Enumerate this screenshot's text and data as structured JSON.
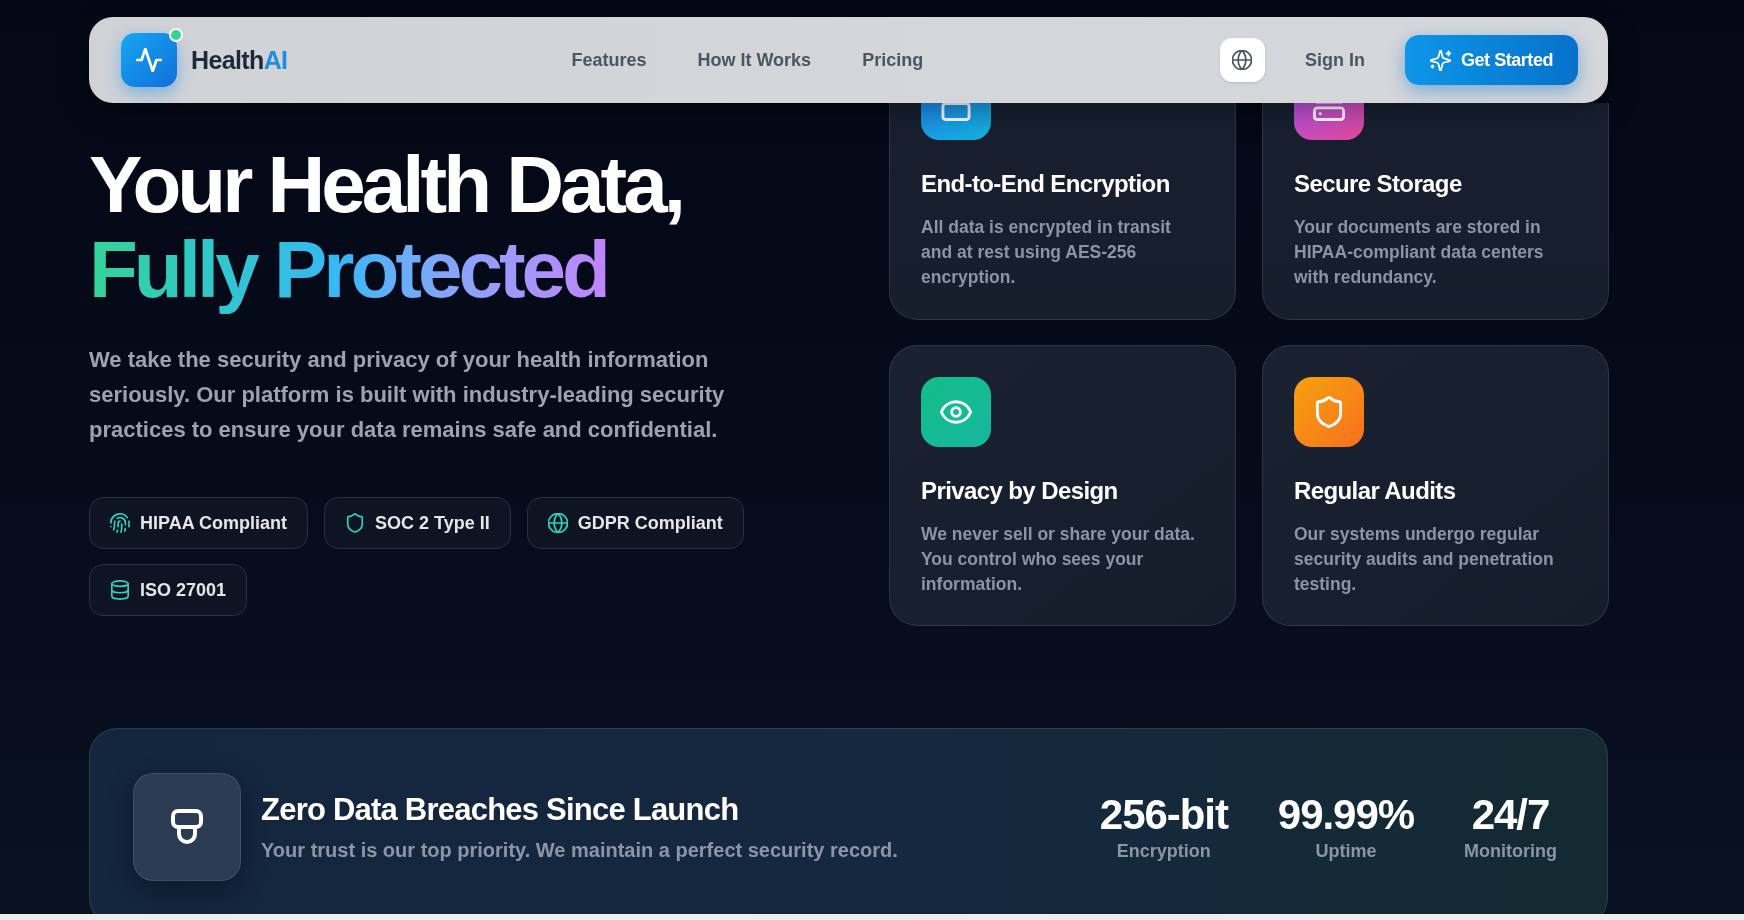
{
  "nav": {
    "brand_parts": [
      "Health",
      "AI"
    ],
    "links": [
      "Features",
      "How It Works",
      "Pricing"
    ],
    "sign_in": "Sign In",
    "cta": "Get Started"
  },
  "hero": {
    "title": "Your Health Data,",
    "title_highlight": "Fully Protected",
    "description": "We take the security and privacy of your health information seriously. Our platform is built with industry-leading security practices to ensure your data remains safe and confidential.",
    "badges": [
      "HIPAA Compliant",
      "SOC 2 Type II",
      "GDPR Compliant",
      "ISO 27001"
    ]
  },
  "features": [
    {
      "title": "End-to-End Encryption",
      "description": "All data is encrypted in transit and at rest using AES-256 encryption."
    },
    {
      "title": "Secure Storage",
      "description": "Your documents are stored in HIPAA-compliant data centers with redundancy."
    },
    {
      "title": "Privacy by Design",
      "description": "We never sell or share your data. You control who sees your information."
    },
    {
      "title": "Regular Audits",
      "description": "Our systems undergo regular security audits and penetration testing."
    }
  ],
  "trust_banner": {
    "title": "Zero Data Breaches Since Launch",
    "subtitle": "Your trust is our top priority. We maintain a perfect security record.",
    "stats": [
      {
        "value": "256-bit",
        "label": "Encryption"
      },
      {
        "value": "99.99%",
        "label": "Uptime"
      },
      {
        "value": "24/7",
        "label": "Monitoring"
      }
    ]
  }
}
